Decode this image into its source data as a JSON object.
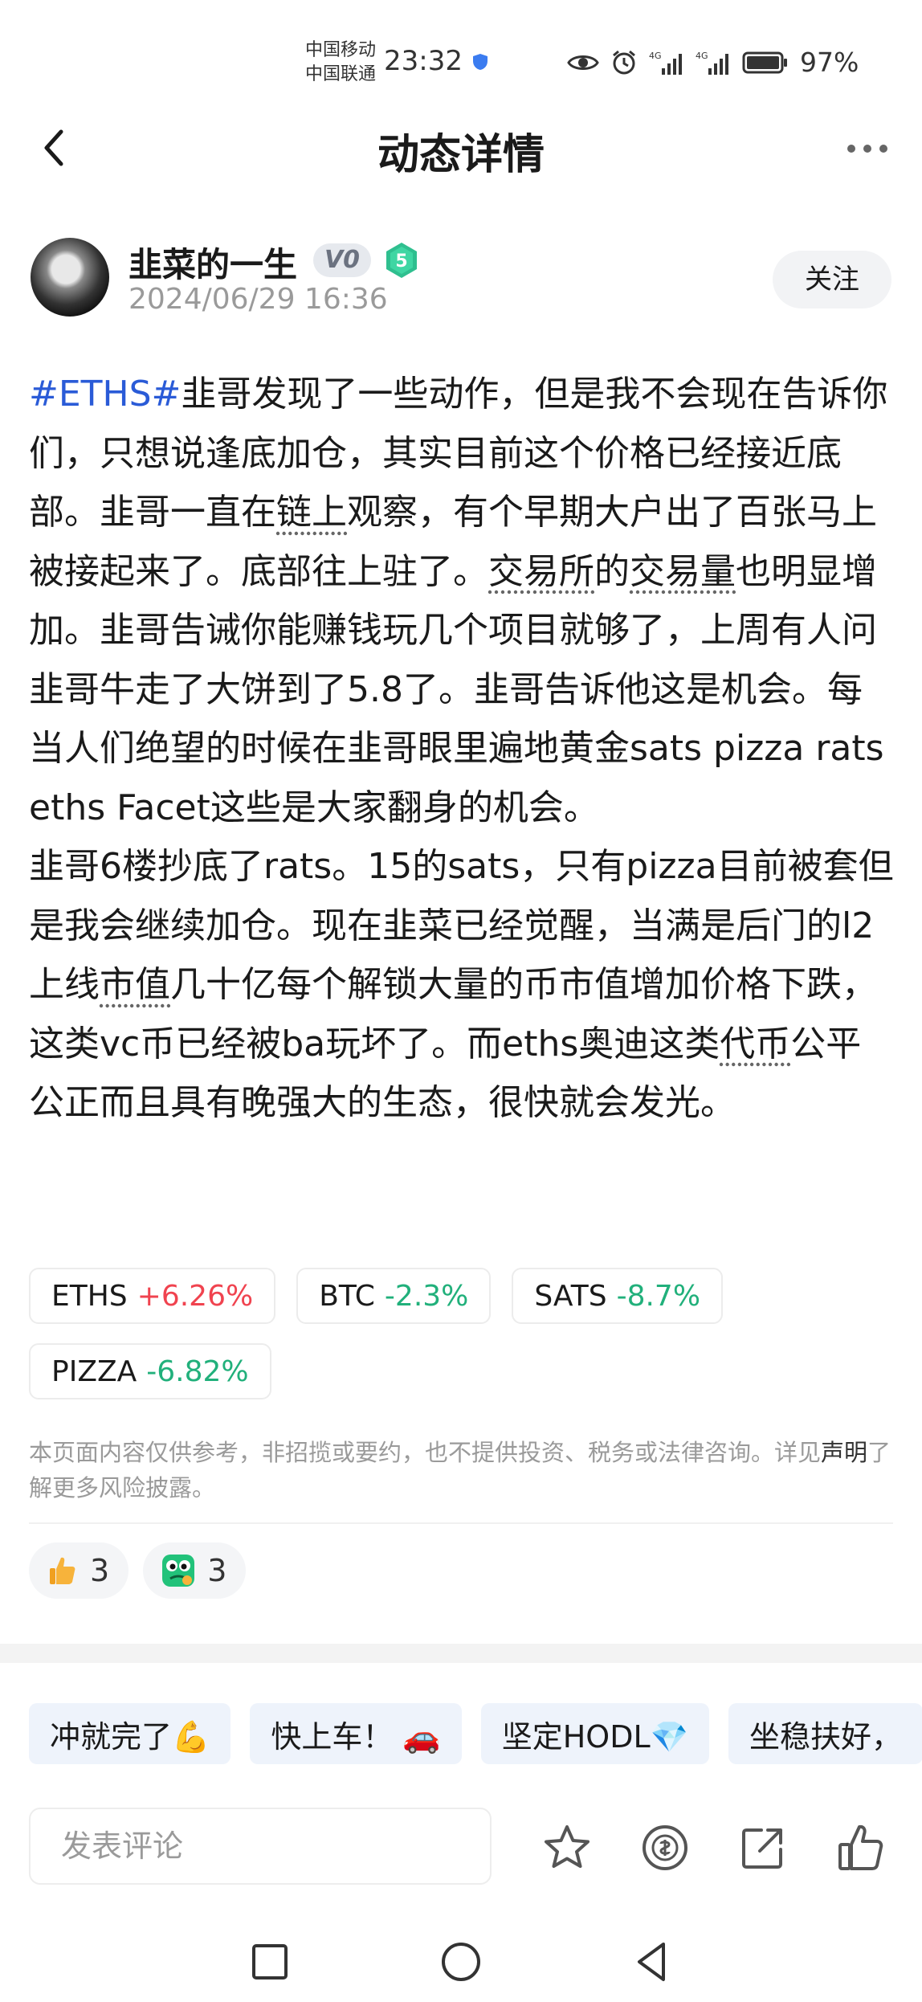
{
  "status_bar": {
    "carrier_1": "中国移动",
    "carrier_2": "中国联通",
    "time": "23:32",
    "battery": "97%",
    "icons": [
      "eye-icon",
      "alarm-icon",
      "signal-4g-icon",
      "signal-4g-icon",
      "battery-icon"
    ]
  },
  "header": {
    "title": "动态详情",
    "back_icon": "chevron-left-icon",
    "more_icon": "more-dots-icon"
  },
  "author": {
    "name": "韭菜的一生",
    "vip_badge": "V0",
    "level_badge": "5",
    "timestamp": "2024/06/29 16:36",
    "follow_label": "关注"
  },
  "post": {
    "hashtag": "#ETHS#",
    "p1_a": "韭哥发现了一些动作，但是我不会现在告诉你们，只想说逢底加仓，其实目前这个价格已经接近底部。韭哥一直在",
    "p1_link1": "链上",
    "p1_b": "观察，有个早期大户出了百张马上被接起来了。底部往上驻了。",
    "p1_link2": "交易所",
    "p1_c": "的",
    "p1_link3": "交易量",
    "p1_d": "也明显增加。韭哥告诫你能赚钱玩几个项目就够了，上周有人问韭哥牛走了大饼到了5.8了。韭哥告诉他这是机会。每当人们绝望的时候在韭哥眼里遍地黄金sats pizza rats  eths Facet这些是大家翻身的机会。",
    "p2_a": "韭哥6楼抄底了rats。15的sats，只有pizza目前被套但是我会继续加仓。现在韭菜已经觉醒，当满是后门的l2上线",
    "p2_link1": "市值",
    "p2_b": "几十亿每个解锁大量的币市值增加价格下跌，这类vc币已经被ba玩坏了。而eths奥迪这类",
    "p2_link2": "代币",
    "p2_c": "公平公正而且具有晚强大的生态，很快就会发光。"
  },
  "coins": [
    {
      "symbol": "ETHS",
      "change": "+6.26%",
      "direction": "up"
    },
    {
      "symbol": "BTC",
      "change": "-2.3%",
      "direction": "down"
    },
    {
      "symbol": "SATS",
      "change": "-8.7%",
      "direction": "down"
    },
    {
      "symbol": "PIZZA",
      "change": "-6.82%",
      "direction": "down"
    }
  ],
  "colors": {
    "up": "#f0434f",
    "down": "#21b07b",
    "hashtag": "#2a5bd7"
  },
  "disclaimer": {
    "text_a": "本页面内容仅供参考，非招揽或要约，也不提供投资、税务或法律咨询。详见",
    "link": "声明",
    "text_b": "了解更多风险披露。"
  },
  "reactions": [
    {
      "icon": "thumbs-up-emoji-icon",
      "count": "3"
    },
    {
      "icon": "green-face-emoji-icon",
      "count": "3"
    }
  ],
  "quick_comments": [
    "冲就完了💪",
    "快上车！ 🚗",
    "坚定HODL💎",
    "坐稳扶好，"
  ],
  "comment_bar": {
    "placeholder": "发表评论",
    "icons": [
      "star-icon",
      "tip-coin-icon",
      "share-icon",
      "like-icon"
    ]
  },
  "nav_bar": {
    "icons": [
      "recent-apps-icon",
      "home-icon",
      "back-triangle-icon"
    ]
  }
}
